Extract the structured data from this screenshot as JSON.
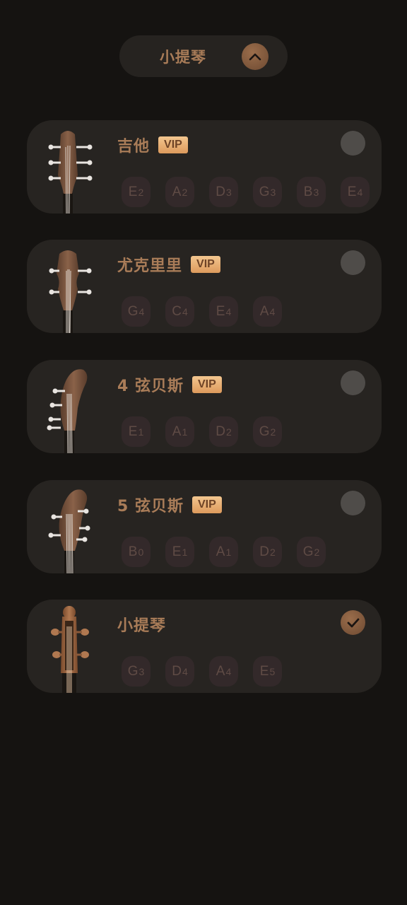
{
  "selector": {
    "label": "小提琴",
    "toggle_icon": "chevron-up-icon"
  },
  "instruments": [
    {
      "id": "guitar",
      "name": "吉他",
      "vip": "VIP",
      "selected": false,
      "notes": [
        [
          "E",
          "2"
        ],
        [
          "A",
          "2"
        ],
        [
          "D",
          "3"
        ],
        [
          "G",
          "3"
        ],
        [
          "B",
          "3"
        ],
        [
          "E",
          "4"
        ]
      ]
    },
    {
      "id": "ukulele",
      "name": "尤克里里",
      "vip": "VIP",
      "selected": false,
      "notes": [
        [
          "G",
          "4"
        ],
        [
          "C",
          "4"
        ],
        [
          "E",
          "4"
        ],
        [
          "A",
          "4"
        ]
      ]
    },
    {
      "id": "bass4",
      "name": "4 弦贝斯",
      "vip": "VIP",
      "selected": false,
      "notes": [
        [
          "E",
          "1"
        ],
        [
          "A",
          "1"
        ],
        [
          "D",
          "2"
        ],
        [
          "G",
          "2"
        ]
      ]
    },
    {
      "id": "bass5",
      "name": "5 弦贝斯",
      "vip": "VIP",
      "selected": false,
      "notes": [
        [
          "B",
          "0"
        ],
        [
          "E",
          "1"
        ],
        [
          "A",
          "1"
        ],
        [
          "D",
          "2"
        ],
        [
          "G",
          "2"
        ]
      ]
    },
    {
      "id": "violin",
      "name": "小提琴",
      "vip": null,
      "selected": true,
      "notes": [
        [
          "G",
          "3"
        ],
        [
          "D",
          "4"
        ],
        [
          "A",
          "4"
        ],
        [
          "E",
          "5"
        ]
      ]
    }
  ],
  "colors": {
    "accent": "#a97c58",
    "card": "#272421",
    "background": "#151311"
  }
}
